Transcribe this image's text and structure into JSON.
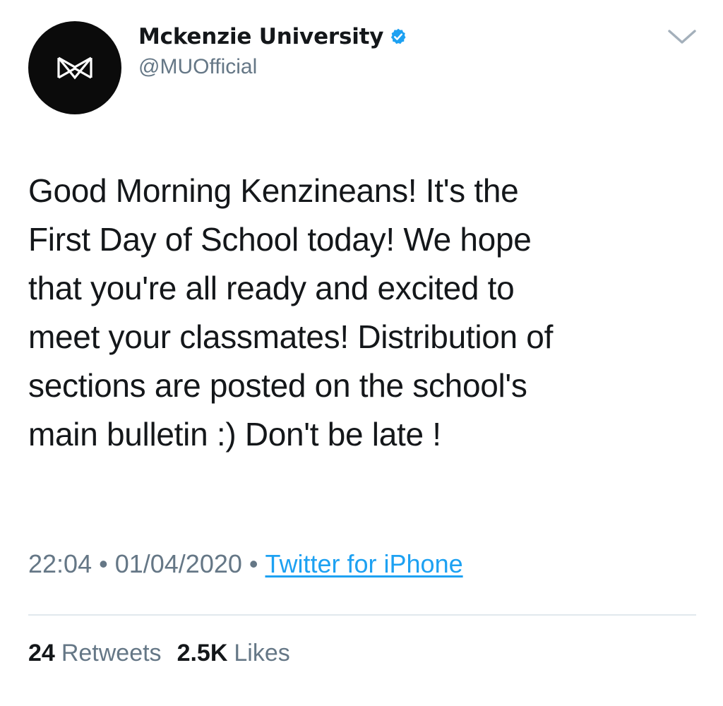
{
  "tweet": {
    "author": {
      "display_name": "Mckenzie University",
      "handle": "@MUOfficial",
      "verified": true,
      "avatar_icon": "mu-logo-icon",
      "avatar_bg": "#0b0b0b"
    },
    "menu_icon": "chevron-down-icon",
    "text": "Good Morning Kenzineans! It's the\nFirst Day of School today! We hope\nthat you're all ready and excited to\nmeet your classmates! Distribution of\nsections are posted on the school's\nmain bulletin :) Don't be late !",
    "time": "22:04",
    "separator": "•",
    "date": "01/04/2020",
    "source": "Twitter for iPhone",
    "stats": {
      "retweets_count": "24",
      "retweets_label": "Retweets",
      "likes_count": "2.5K",
      "likes_label": "Likes"
    }
  },
  "colors": {
    "text_primary": "#14171a",
    "text_secondary": "#657786",
    "link": "#1da1f2",
    "verified_badge": "#1da1f2",
    "divider": "#e1e8ed"
  }
}
